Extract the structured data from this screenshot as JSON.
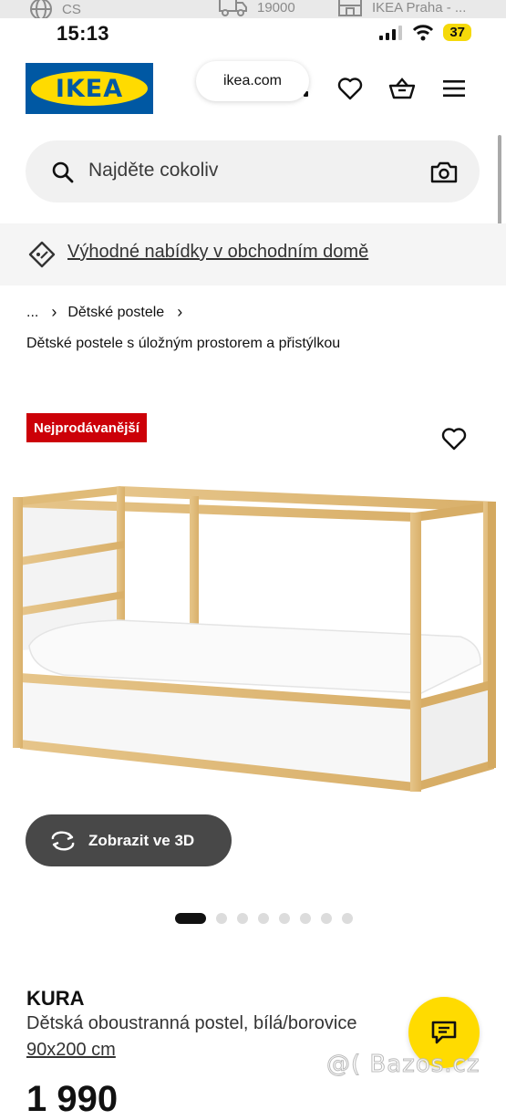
{
  "status_bar": {
    "faded_row": {
      "lang": "CS",
      "count": "19000",
      "store": "IKEA Praha - ..."
    },
    "time": "15:13",
    "battery": "37"
  },
  "header": {
    "logo_text": "IKEA",
    "url": "ikea.com"
  },
  "search": {
    "placeholder": "Najděte cokoliv"
  },
  "banner": {
    "text": "Výhodné nabídky v obchodním domě"
  },
  "breadcrumb": {
    "ellipsis": "...",
    "category": "Dětské postele"
  },
  "category_title": "Dětské postele s úložným prostorem a přistýlkou",
  "product": {
    "badge": "Nejprodávanější",
    "view_3d_label": "Zobrazit ve 3D",
    "gallery_total": 8,
    "gallery_current": 1,
    "name": "KURA",
    "description": "Dětská oboustranná postel, bílá/borovice",
    "size": "90x200 cm",
    "price": "1 990"
  },
  "watermark": "@( Bazos.cz",
  "colors": {
    "brand_blue": "#0058a3",
    "brand_yellow": "#ffdb00",
    "badge_red": "#cc0008",
    "button_dark": "#484848"
  }
}
